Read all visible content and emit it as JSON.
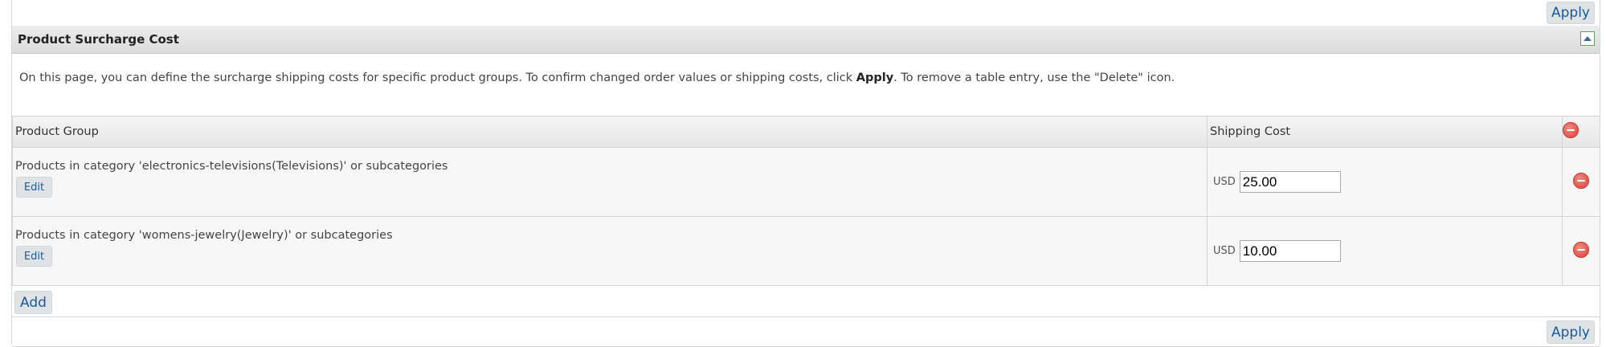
{
  "toolbar": {
    "apply_label": "Apply"
  },
  "section": {
    "title": "Product Surcharge Cost",
    "description_prefix": "On this page, you can define the surcharge shipping costs for specific product groups. To confirm changed order values or shipping costs, click ",
    "description_bold": "Apply",
    "description_suffix": ". To remove a table entry, use the \"Delete\" icon."
  },
  "table": {
    "columns": [
      "Product Group",
      "Shipping Cost"
    ],
    "rows": [
      {
        "product_group": "Products in category 'electronics-televisions(Televisions)' or subcategories",
        "edit_label": "Edit",
        "currency": "USD",
        "cost": "25.00"
      },
      {
        "product_group": "Products in category 'womens-jewelry(Jewelry)' or subcategories",
        "edit_label": "Edit",
        "currency": "USD",
        "cost": "10.00"
      }
    ],
    "add_label": "Add"
  },
  "icons": {
    "delete": "delete-icon",
    "collapse": "collapse-up-icon"
  },
  "colors": {
    "link_blue": "#1b5a9a",
    "delete_red": "#d9443a"
  }
}
